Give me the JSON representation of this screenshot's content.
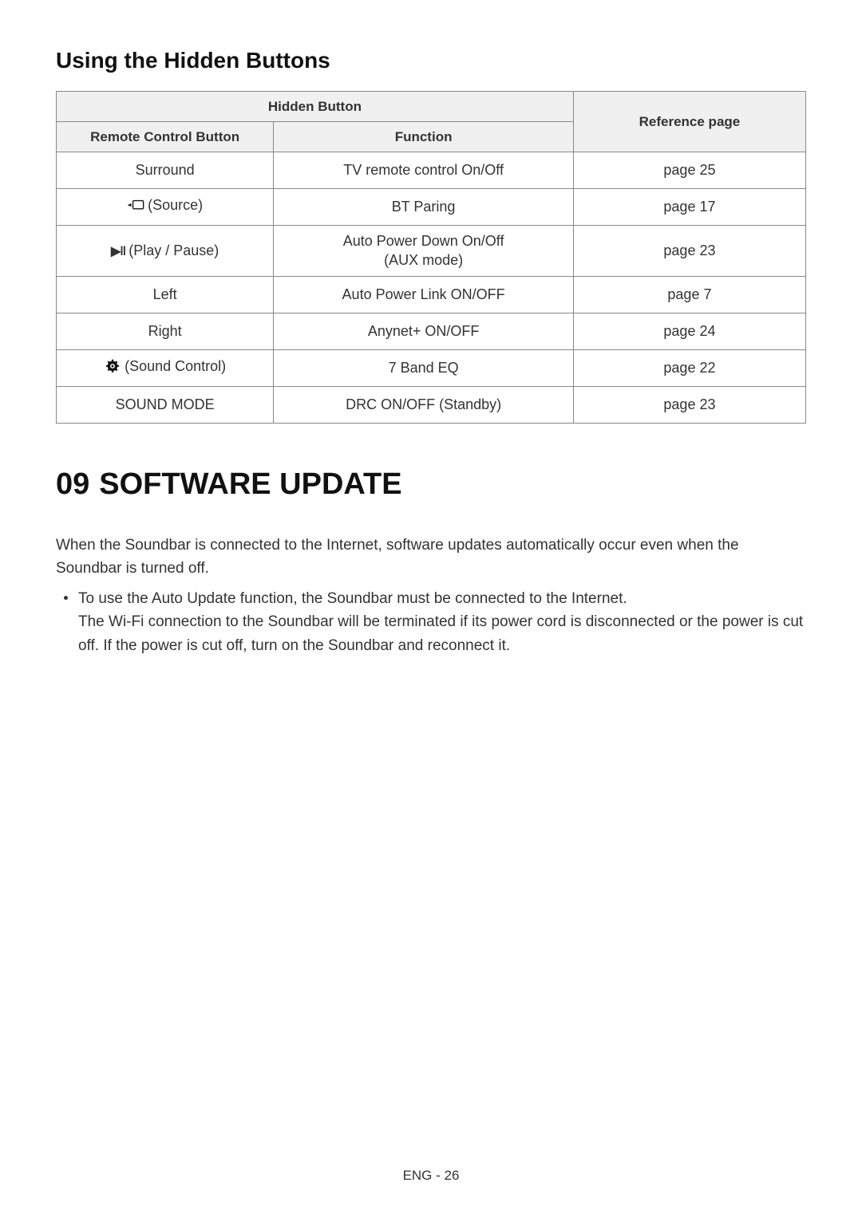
{
  "section_heading": "Using the Hidden Buttons",
  "table": {
    "header_group": "Hidden Button",
    "header_remote": "Remote Control Button",
    "header_function": "Function",
    "header_ref": "Reference page",
    "rows": [
      {
        "remote": "Surround",
        "func": "TV remote control On/Off",
        "ref": "page 25",
        "icon": null
      },
      {
        "remote": "(Source)",
        "func": "BT Paring",
        "ref": "page 17",
        "icon": "source"
      },
      {
        "remote": "(Play / Pause)",
        "func_line1": "Auto Power Down On/Off",
        "func_line2": "(AUX mode)",
        "ref": "page 23",
        "icon": "playpause"
      },
      {
        "remote": "Left",
        "func": "Auto Power Link ON/OFF",
        "ref": "page 7",
        "icon": null
      },
      {
        "remote": "Right",
        "func": "Anynet+ ON/OFF",
        "ref": "page 24",
        "icon": null
      },
      {
        "remote": "(Sound Control)",
        "func": "7 Band EQ",
        "ref": "page 22",
        "icon": "gear"
      },
      {
        "remote": "SOUND MODE",
        "func": "DRC ON/OFF (Standby)",
        "ref": "page 23",
        "icon": null
      }
    ]
  },
  "chapter": {
    "num": "09",
    "title": "SOFTWARE UPDATE"
  },
  "paragraph": "When the Soundbar is connected to the Internet, software updates automatically occur even when the Soundbar is turned off.",
  "bullet_line1": "To use the Auto Update function, the Soundbar must be connected to the Internet.",
  "bullet_line2": "The Wi-Fi connection to the Soundbar will be terminated if its power cord is disconnected or the power is cut off. If the power is cut off, turn on the Soundbar and reconnect it.",
  "footer": "ENG - 26"
}
